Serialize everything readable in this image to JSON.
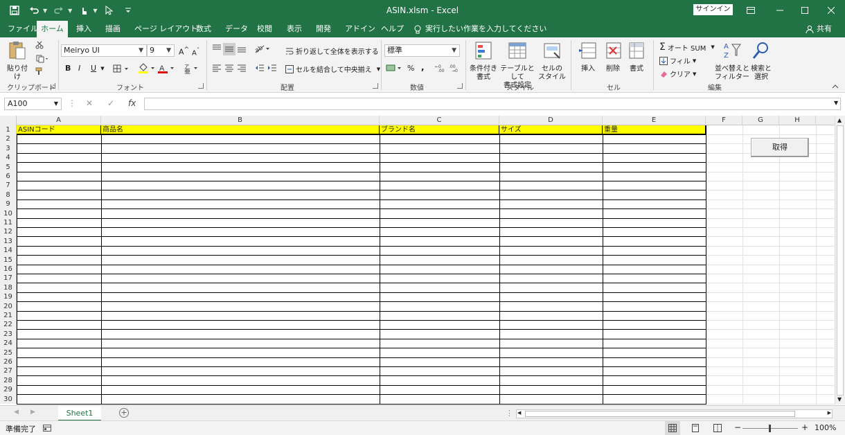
{
  "window": {
    "title": "ASIN.xlsm  -  Excel",
    "signin": "サインイン"
  },
  "tabs": [
    "ファイル",
    "ホーム",
    "挿入",
    "描画",
    "ページ レイアウト",
    "数式",
    "データ",
    "校閲",
    "表示",
    "開発",
    "アドイン",
    "ヘルプ"
  ],
  "active_tab": "ホーム",
  "tell_me": "実行したい作業を入力してください",
  "share": "共有",
  "ribbon": {
    "clipboard": {
      "label": "クリップボード",
      "paste": "貼り付け"
    },
    "font": {
      "label": "フォント",
      "name": "Meiryo UI",
      "size": "9",
      "bold": "B",
      "italic": "I",
      "underline": "U",
      "grow": "A",
      "shrink": "A"
    },
    "alignment": {
      "label": "配置",
      "wrap": "折り返して全体を表示する",
      "merge": "セルを結合して中央揃え"
    },
    "number": {
      "label": "数値",
      "format": "標準",
      "percent": "%",
      "comma": ","
    },
    "styles": {
      "label": "スタイル",
      "conditional_1": "条件付き",
      "conditional_2": "書式",
      "table_1": "テーブルとして",
      "table_2": "書式設定",
      "cell_1": "セルの",
      "cell_2": "スタイル"
    },
    "cells": {
      "label": "セル",
      "insert": "挿入",
      "delete": "削除",
      "format": "書式"
    },
    "editing": {
      "label": "編集",
      "autosum": "オート SUM",
      "fill": "フィル",
      "clear": "クリア",
      "sort_1": "並べ替えと",
      "sort_2": "フィルター",
      "find_1": "検索と",
      "find_2": "選択"
    }
  },
  "formula_bar": {
    "name_box": "A100",
    "fx": "fx",
    "value": ""
  },
  "columns": [
    "A",
    "B",
    "C",
    "D",
    "E",
    "F",
    "G",
    "H"
  ],
  "header_row": [
    "ASINコード",
    "商品名",
    "ブランド名",
    "サイズ",
    "重量"
  ],
  "rows": [
    "1",
    "2",
    "3",
    "4",
    "5",
    "6",
    "7",
    "8",
    "9",
    "10",
    "11",
    "12",
    "13",
    "14",
    "15",
    "16",
    "17",
    "18",
    "19",
    "20",
    "21",
    "22",
    "23",
    "24",
    "25",
    "26",
    "27",
    "28",
    "29",
    "30"
  ],
  "button_label": "取得",
  "sheet_tab": "Sheet1",
  "status": {
    "ready": "準備完了",
    "zoom": "100%"
  },
  "colors": {
    "excel_green": "#217346",
    "header_fill": "#ffff00"
  }
}
